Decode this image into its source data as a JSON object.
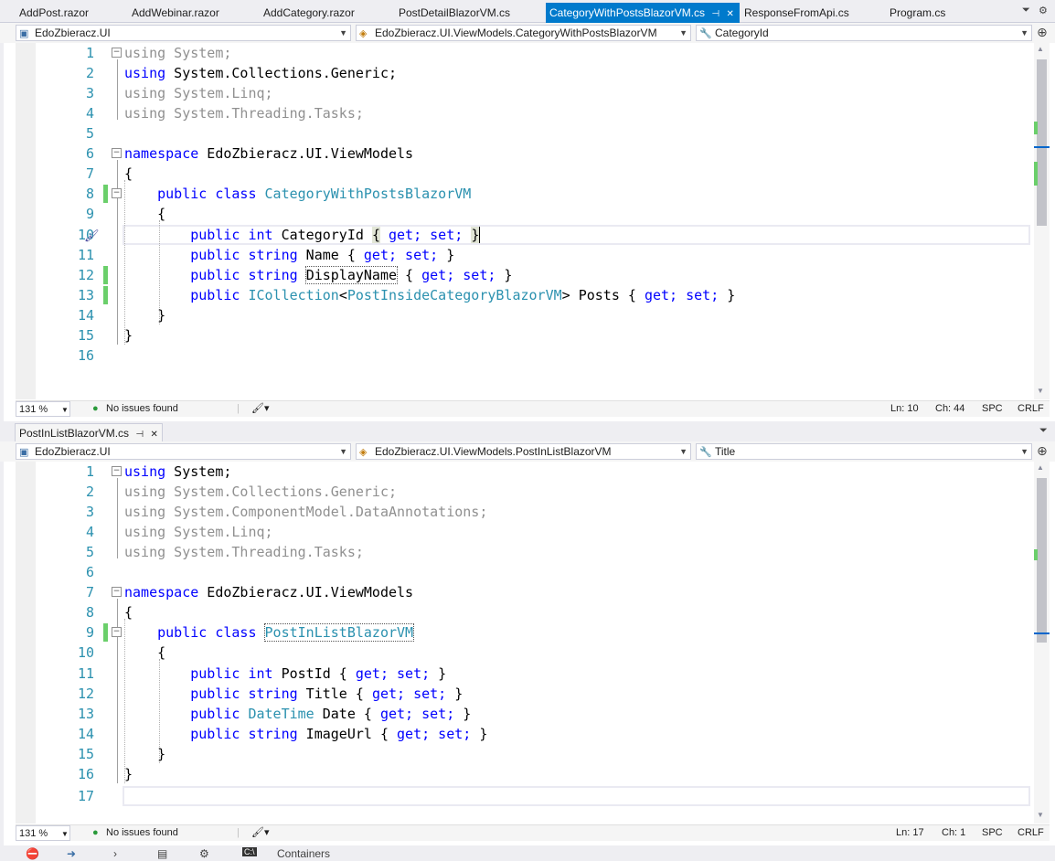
{
  "tabs": [
    {
      "label": "AddPost.razor"
    },
    {
      "label": "AddWebinar.razor"
    },
    {
      "label": "AddCategory.razor"
    },
    {
      "label": "PostDetailBlazorVM.cs"
    },
    {
      "label": "CategoryWithPostsBlazorVM.cs",
      "active": true
    },
    {
      "label": "ResponseFromApi.cs"
    },
    {
      "label": "Program.cs"
    }
  ],
  "tab_strip": {
    "pin_glyph": "⊣",
    "close_glyph": "✕",
    "dropdown_glyph": "⏷",
    "settings_glyph": "⚙"
  },
  "pane1": {
    "nav": {
      "project": "EdoZbieracz.UI",
      "type": "EdoZbieracz.UI.ViewModels.CategoryWithPostsBlazorVM",
      "member": "CategoryId"
    },
    "lines": [
      {
        "n": "1"
      },
      {
        "n": "2"
      },
      {
        "n": "3"
      },
      {
        "n": "4"
      },
      {
        "n": "5"
      },
      {
        "n": "6"
      },
      {
        "n": "7"
      },
      {
        "n": "8"
      },
      {
        "n": "9"
      },
      {
        "n": "10"
      },
      {
        "n": "11"
      },
      {
        "n": "12"
      },
      {
        "n": "13"
      },
      {
        "n": "14"
      },
      {
        "n": "15"
      },
      {
        "n": "16"
      }
    ],
    "code": {
      "l1_kw": "using",
      "l1_rest": " System;",
      "l2_kw": "using",
      "l2_rest": " System.Collections.Generic;",
      "l3": "using System.Linq;",
      "l4": "using System.Threading.Tasks;",
      "l6_kw": "namespace",
      "l6_rest": " EdoZbieracz.UI.ViewModels",
      "l7": "{",
      "l8_kw": "public class",
      "l8_ty": "CategoryWithPostsBlazorVM",
      "l9": "{",
      "l10_kw": "public int",
      "l10_name": " CategoryId ",
      "l10_b1": "{",
      "l10_acc": " get; set; ",
      "l10_b2": "}",
      "l11_kw": "public string",
      "l11_name": " Name { ",
      "l11_acc": "get; set;",
      "l11_end": " }",
      "l12_kw": "public string",
      "l12_name": "DisplayName",
      "l12_open": " { ",
      "l12_acc": "get; set;",
      "l12_end": " }",
      "l13_kw": "public",
      "l13_ty1": "ICollection",
      "l13_lt": "<",
      "l13_ty2": "PostInsideCategoryBlazorVM",
      "l13_gt": ">",
      "l13_name": " Posts { ",
      "l13_acc": "get; set;",
      "l13_end": " }",
      "l14": "}",
      "l15": "}"
    },
    "status": {
      "zoom": "131 %",
      "issues": "No issues found",
      "ln": "Ln: 10",
      "ch": "Ch: 44",
      "ws": "SPC",
      "eol": "CRLF"
    }
  },
  "pane2": {
    "tab": {
      "label": "PostInListBlazorVM.cs"
    },
    "nav": {
      "project": "EdoZbieracz.UI",
      "type": "EdoZbieracz.UI.ViewModels.PostInListBlazorVM",
      "member": "Title"
    },
    "lines": [
      {
        "n": "1"
      },
      {
        "n": "2"
      },
      {
        "n": "3"
      },
      {
        "n": "4"
      },
      {
        "n": "5"
      },
      {
        "n": "6"
      },
      {
        "n": "7"
      },
      {
        "n": "8"
      },
      {
        "n": "9"
      },
      {
        "n": "10"
      },
      {
        "n": "11"
      },
      {
        "n": "12"
      },
      {
        "n": "13"
      },
      {
        "n": "14"
      },
      {
        "n": "15"
      },
      {
        "n": "16"
      },
      {
        "n": "17"
      }
    ],
    "code": {
      "l1_kw": "using",
      "l1_rest": " System;",
      "l2": "using System.Collections.Generic;",
      "l3": "using System.ComponentModel.DataAnnotations;",
      "l4": "using System.Linq;",
      "l5": "using System.Threading.Tasks;",
      "l7_kw": "namespace",
      "l7_rest": " EdoZbieracz.UI.ViewModels",
      "l8": "{",
      "l9_kw": "public class",
      "l9_ty": "PostInListBlazorVM",
      "l10": "{",
      "l11_kw": "public int",
      "l11_name": " PostId { ",
      "l11_acc": "get; set;",
      "l11_end": " }",
      "l12_kw": "public string",
      "l12_name": " Title { ",
      "l12_acc": "get; set;",
      "l12_end": " }",
      "l13_kw": "public",
      "l13_ty": "DateTime",
      "l13_name": " Date { ",
      "l13_acc": "get; set;",
      "l13_end": " }",
      "l14_kw": "public string",
      "l14_name": " ImageUrl { ",
      "l14_acc": "get; set;",
      "l14_end": " }",
      "l15": "}",
      "l16": "}"
    },
    "status": {
      "zoom": "131 %",
      "issues": "No issues found",
      "ln": "Ln: 17",
      "ch": "Ch: 1",
      "ws": "SPC",
      "eol": "CRLF"
    }
  },
  "bottom_toolbar": {
    "containers": "Containers"
  },
  "colors": {
    "accent": "#007acc",
    "keyword": "#0000ff",
    "type": "#2b91af",
    "change_margin": "#6bcf6b"
  }
}
